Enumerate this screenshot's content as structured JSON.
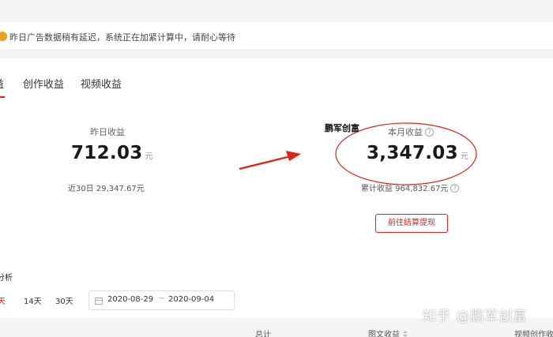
{
  "notice": {
    "text": "昨日广告数据稍有延迟，系统正在加紧计算中，请耐心等待"
  },
  "tabs": [
    {
      "label": "益"
    },
    {
      "label": "创作收益"
    },
    {
      "label": "视频收益"
    }
  ],
  "yesterday": {
    "label": "昨日收益",
    "value": "712.03",
    "unit": "元",
    "recent_label": "近30日 29,347.67元"
  },
  "month": {
    "label": "本月收益",
    "value": "3,347.03",
    "unit": "元",
    "total_label": "累计收益 964,832.67元",
    "help_icon": "?"
  },
  "annotation": {
    "label": "鹏军创富",
    "color": "#e2231a"
  },
  "withdraw_button": "前往结算提现",
  "analysis": {
    "title": "分析",
    "ranges": [
      "天",
      "14天",
      "30天"
    ],
    "date_start": "2020-08-29",
    "date_separator": "~",
    "date_end": "2020-09-04"
  },
  "table": {
    "headers": [
      "总计",
      "图文收益",
      "视频创作收"
    ]
  },
  "watermark": "知乎 @鹏军创富",
  "colors": {
    "accent": "#e2231a",
    "notice_icon": "#f0a020"
  }
}
